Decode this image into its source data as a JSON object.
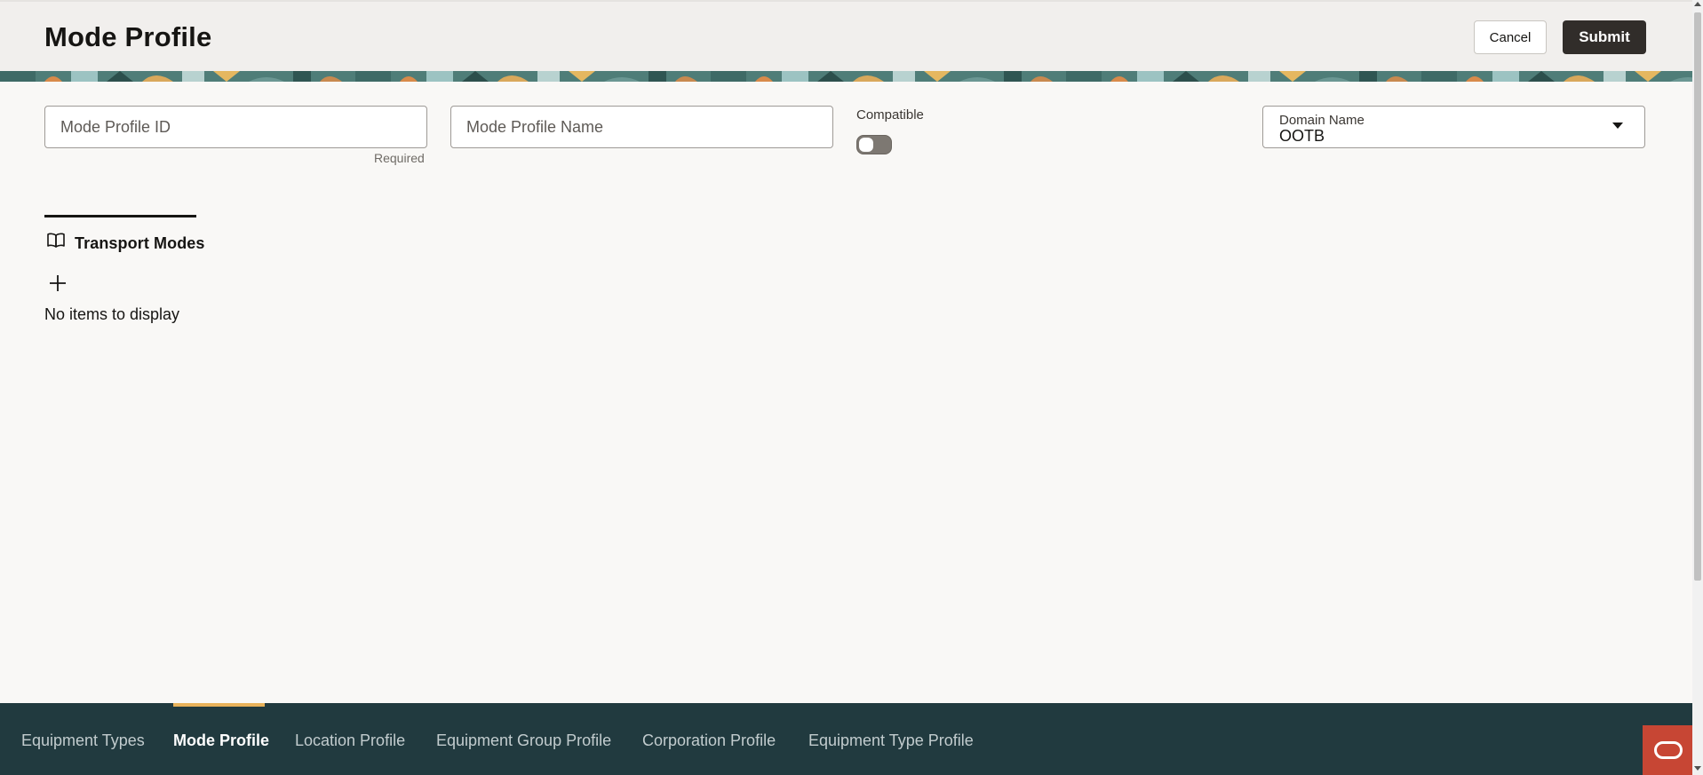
{
  "header": {
    "title": "Mode Profile",
    "cancel_label": "Cancel",
    "submit_label": "Submit"
  },
  "form": {
    "mode_profile_id": {
      "placeholder": "Mode Profile ID",
      "value": "",
      "helper": "Required"
    },
    "mode_profile_name": {
      "placeholder": "Mode Profile Name",
      "value": ""
    },
    "compatible": {
      "label": "Compatible",
      "checked": false
    },
    "domain_name": {
      "label": "Domain Name",
      "value": "OOTB"
    }
  },
  "transport_modes": {
    "title": "Transport Modes",
    "icon": "book-icon",
    "add_icon": "plus-icon",
    "empty_message": "No items to display"
  },
  "bottom_nav": {
    "tabs": [
      {
        "label": "Equipment Types",
        "active": false
      },
      {
        "label": "Mode Profile",
        "active": true
      },
      {
        "label": "Location Profile",
        "active": false
      },
      {
        "label": "Equipment Group Profile",
        "active": false
      },
      {
        "label": "Corporation Profile",
        "active": false
      },
      {
        "label": "Equipment Type Profile",
        "active": false
      }
    ],
    "active_indicator_color": "#e8b25a",
    "background_color": "#213a3f"
  },
  "colors": {
    "submit_button": "#312d2a",
    "oracle_brand": "#c74634"
  },
  "oracle_button": {
    "icon": "oracle-logo-icon"
  }
}
